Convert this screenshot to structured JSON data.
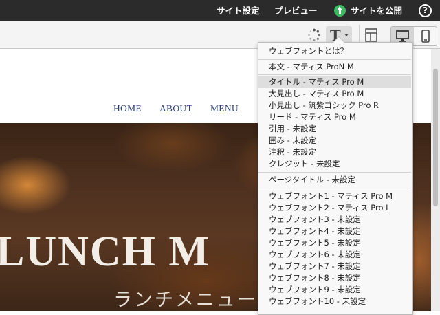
{
  "topbar": {
    "site_settings": "サイト設定",
    "preview": "プレビュー",
    "publish": "サイトを公開",
    "help": "?"
  },
  "toolbar": {
    "font_button": "T"
  },
  "site": {
    "nav": [
      "HOME",
      "ABOUT",
      "MENU"
    ],
    "hero_title": "LUNCH M",
    "hero_subtitle": "ランチメニュー"
  },
  "font_menu": {
    "about": "ウェブフォントとは？",
    "body": "本文 - マティス ProN M",
    "groups": [
      [
        "タイトル - マティス Pro M",
        "大見出し - マティス Pro M",
        "小見出し - 筑紫ゴシック Pro R",
        "リード - マティス Pro M",
        "引用 - 未設定",
        "囲み - 未設定",
        "注釈 - 未設定",
        "クレジット - 未設定"
      ],
      [
        "ページタイトル - 未設定"
      ],
      [
        "ウェブフォント1 - マティス Pro M",
        "ウェブフォント2 - マティス Pro L",
        "ウェブフォント3 - 未設定",
        "ウェブフォント4 - 未設定",
        "ウェブフォント5 - 未設定",
        "ウェブフォント6 - 未設定",
        "ウェブフォント7 - 未設定",
        "ウェブフォント8 - 未設定",
        "ウェブフォント9 - 未設定",
        "ウェブフォント10 - 未設定"
      ]
    ]
  },
  "colors": {
    "topbar_bg": "#2b2b2b",
    "publish_accent": "#3dba5f",
    "nav_text": "#2f4475",
    "menu_highlight": "#dedede"
  }
}
